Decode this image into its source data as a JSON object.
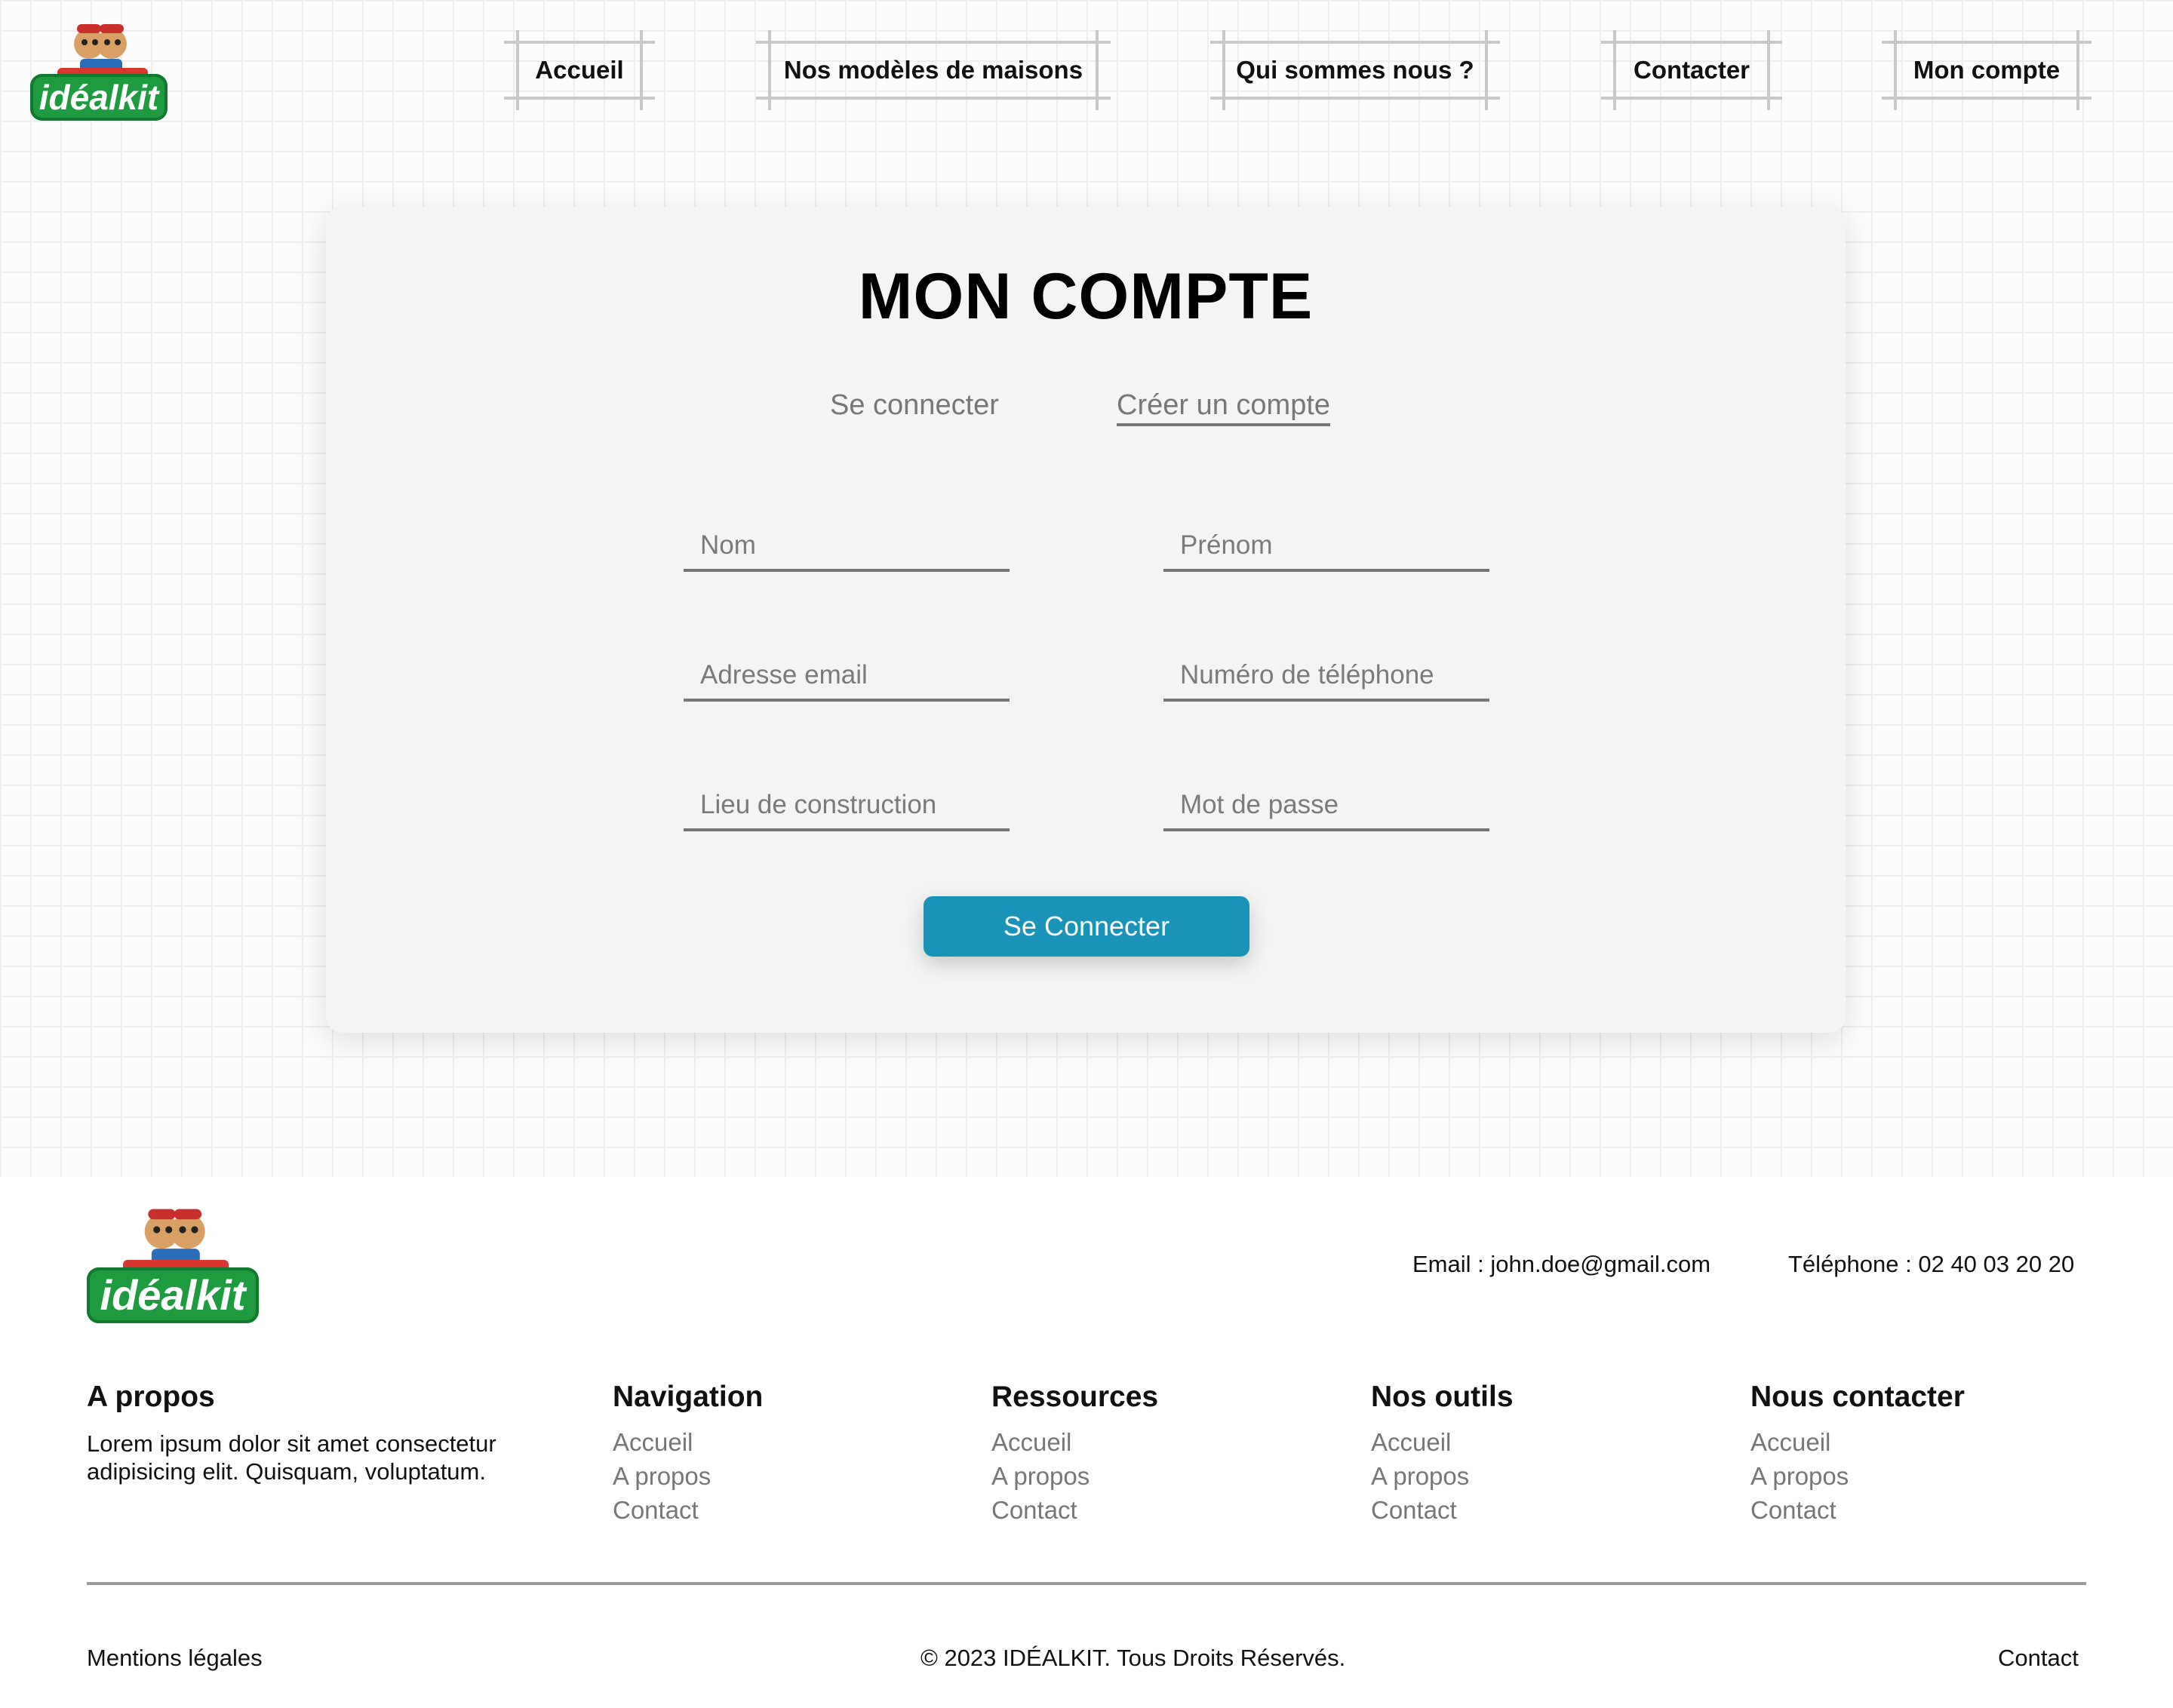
{
  "brand": {
    "logo_text": "idéalkit",
    "colors": {
      "green": "#1e9a3f",
      "red": "#d9362f",
      "accent": "#1a93b8"
    }
  },
  "nav": {
    "items": [
      {
        "label": "Accueil"
      },
      {
        "label": "Nos modèles de maisons"
      },
      {
        "label": "Qui sommes nous ?"
      },
      {
        "label": "Contacter"
      },
      {
        "label": "Mon compte"
      }
    ]
  },
  "account": {
    "title": "MON COMPTE",
    "tabs": {
      "login": "Se connecter",
      "register": "Créer un compte"
    },
    "fields": {
      "nom": "Nom",
      "prenom": "Prénom",
      "email": "Adresse email",
      "telephone": "Numéro de téléphone",
      "lieu": "Lieu de construction",
      "password": "Mot de passe"
    },
    "submit": "Se Connecter"
  },
  "footer": {
    "email": "Email : john.doe@gmail.com",
    "phone": "Téléphone : 02 40 03 20 20",
    "about": {
      "title": "A propos",
      "text": "Lorem ipsum dolor sit amet consectetur adipisicing elit. Quisquam, voluptatum."
    },
    "columns": [
      {
        "title": "Navigation",
        "links": [
          "Accueil",
          "A propos",
          "Contact"
        ]
      },
      {
        "title": "Ressources",
        "links": [
          "Accueil",
          "A propos",
          "Contact"
        ]
      },
      {
        "title": "Nos outils",
        "links": [
          "Accueil",
          "A propos",
          "Contact"
        ]
      },
      {
        "title": "Nous contacter",
        "links": [
          "Accueil",
          "A propos",
          "Contact"
        ]
      }
    ],
    "legal": "Mentions légales",
    "copyright": "© 2023 IDÉALKIT. Tous Droits Réservés.",
    "contact": "Contact"
  }
}
